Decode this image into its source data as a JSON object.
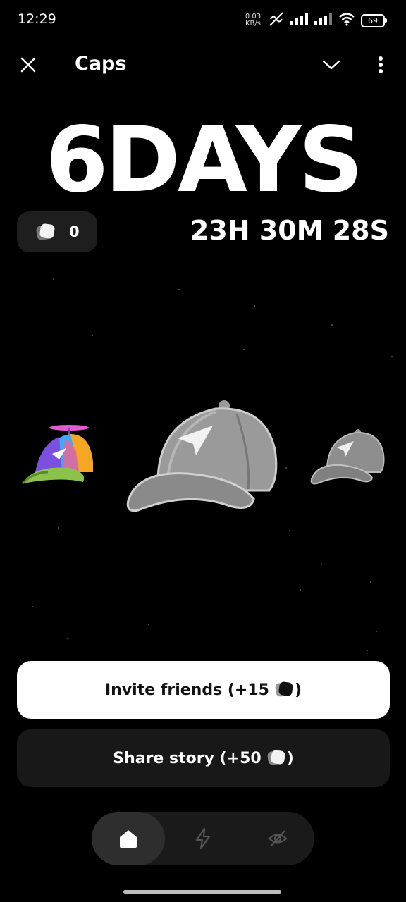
{
  "status_bar": {
    "time": "12:29",
    "net_speed_value": "0.03",
    "net_speed_unit": "KB/s",
    "battery": "69"
  },
  "header": {
    "title": "Caps"
  },
  "countdown": {
    "days": "6DAYS",
    "hms": "23H 30M 28S"
  },
  "balance": {
    "value": "0"
  },
  "items": [
    {
      "name": "propeller-cap",
      "selected": false
    },
    {
      "name": "grey-telegram-cap",
      "selected": true
    },
    {
      "name": "grey-telegram-cap-small",
      "selected": false
    }
  ],
  "buttons": {
    "invite_label": "Invite friends (+15",
    "invite_suffix": ")",
    "share_label": "Share story (+50",
    "share_suffix": ")"
  },
  "nav": {
    "items": [
      {
        "icon": "home-icon",
        "active": true
      },
      {
        "icon": "bolt-icon",
        "active": false
      },
      {
        "icon": "hidden-eye-icon",
        "active": false
      }
    ]
  }
}
